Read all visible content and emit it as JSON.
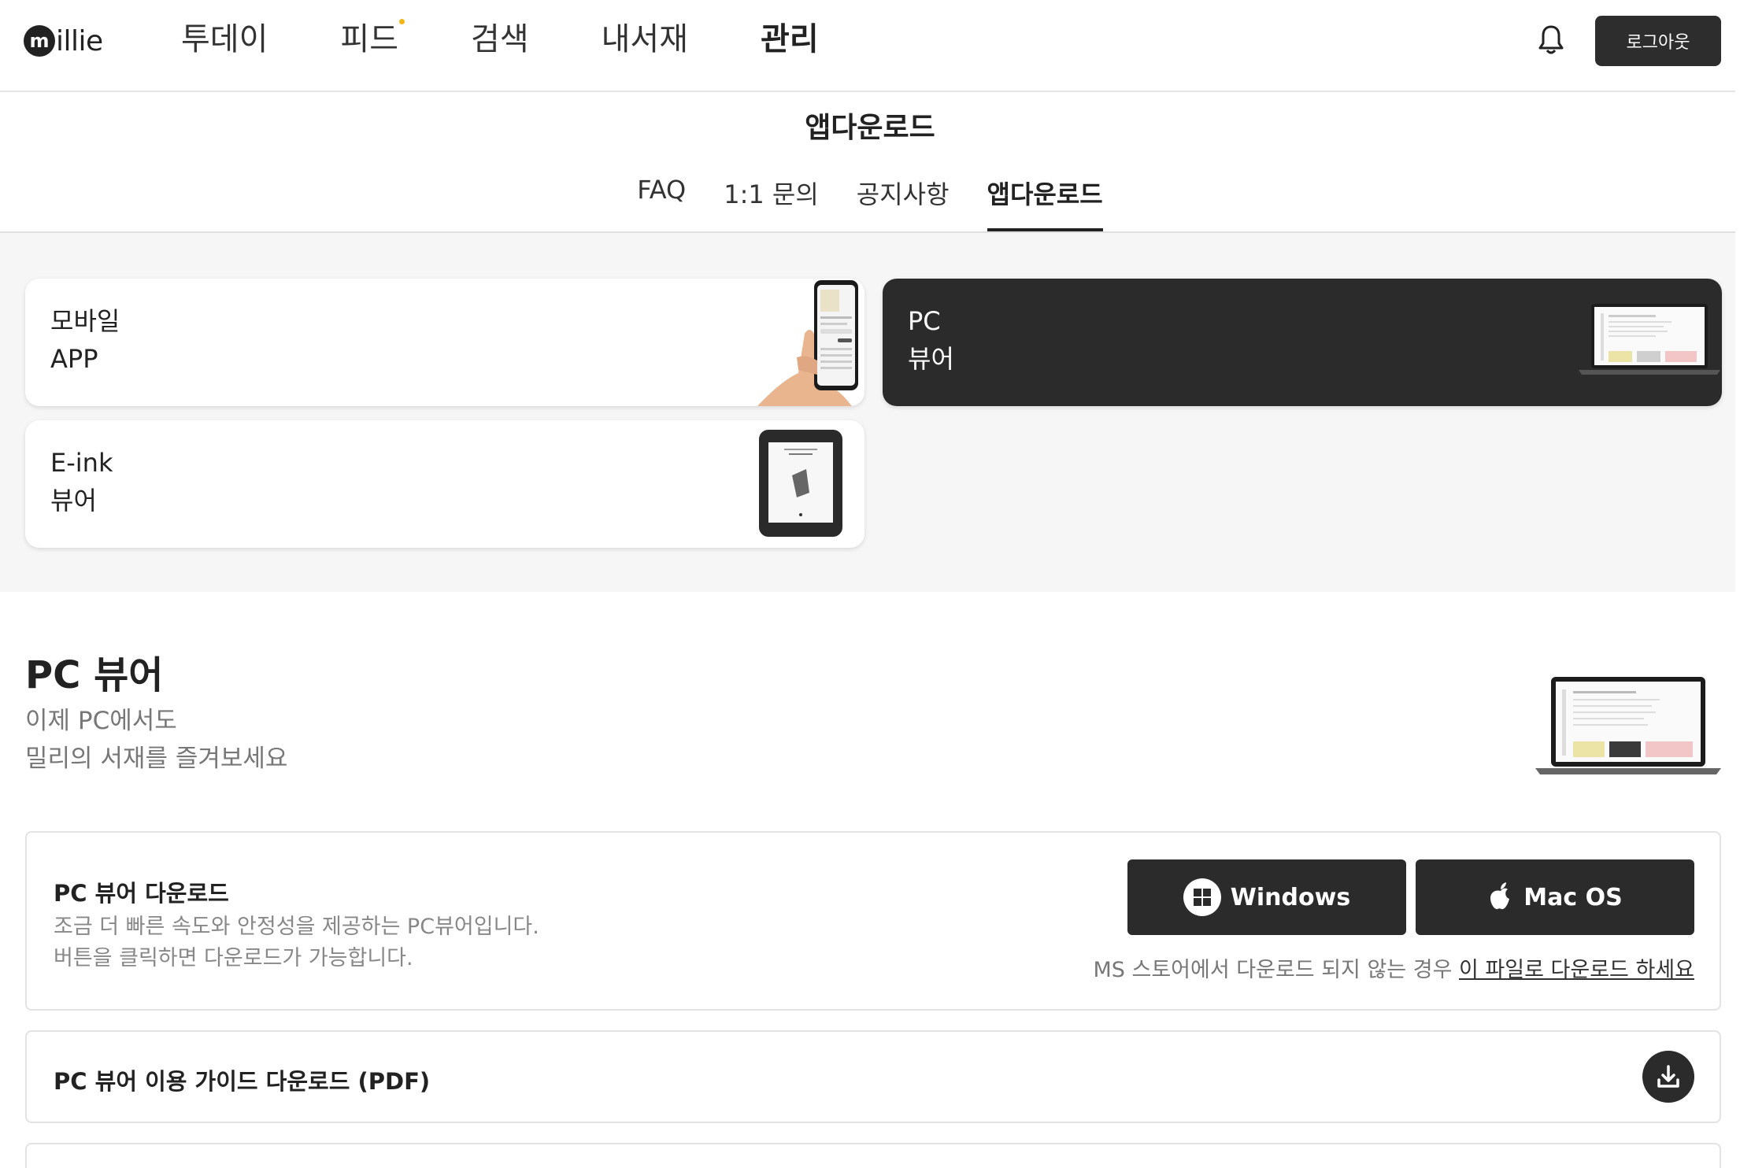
{
  "header": {
    "logo_text": "illie",
    "logo_mark": "m",
    "nav": [
      "투데이",
      "피드",
      "검색",
      "내서재",
      "관리"
    ],
    "active_nav": "관리",
    "feed_dot_color": "#f2b619",
    "bell_icon": "bell-icon",
    "logout_label": "로그아웃"
  },
  "page_title": "앱다운로드",
  "tabs": [
    "FAQ",
    "1:1 문의",
    "공지사항",
    "앱다운로드"
  ],
  "active_tab": "앱다운로드",
  "cards": {
    "mobile": {
      "line1": "모바일",
      "line2": "APP"
    },
    "pc": {
      "line1": "PC",
      "line2": "뷰어"
    },
    "eink": {
      "line1": "E-ink",
      "line2": "뷰어"
    }
  },
  "pc_section": {
    "title": "PC 뷰어",
    "sub1": "이제 PC에서도",
    "sub2": "밀리의 서재를 즐겨보세요"
  },
  "download": {
    "title": "PC 뷰어 다운로드",
    "desc1": "조금 더 빠른 속도와 안정성을 제공하는 PC뷰어입니다.",
    "desc2": "버튼을 클릭하면 다운로드가 가능합니다.",
    "windows_label": "Windows",
    "mac_label": "Mac OS",
    "note_prefix": "MS 스토어에서 다운로드 되지 않는 경우 ",
    "note_link": "이 파일로 다운로드 하세요"
  },
  "guide": {
    "title": "PC 뷰어 이용 가이드 다운로드 (PDF)",
    "icon": "download-icon"
  },
  "colors": {
    "dark": "#2b2b2b",
    "accent_dot": "#f2b619",
    "muted_text": "#888888"
  }
}
